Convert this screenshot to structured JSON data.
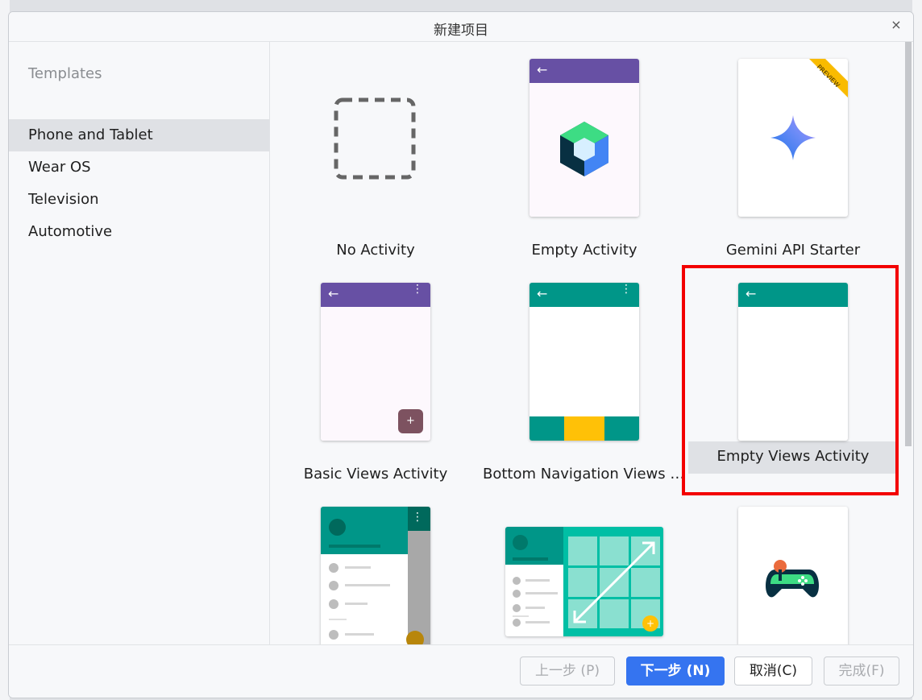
{
  "dialog": {
    "title": "新建项目",
    "close_glyph": "×"
  },
  "sidebar": {
    "header": "Templates",
    "items": [
      {
        "label": "Phone and Tablet",
        "selected": true
      },
      {
        "label": "Wear OS"
      },
      {
        "label": "Television"
      },
      {
        "label": "Automotive"
      }
    ]
  },
  "templates": [
    {
      "label": "No Activity"
    },
    {
      "label": "Empty Activity"
    },
    {
      "label": "Gemini API Starter",
      "badge": "PREVIEW"
    },
    {
      "label": "Basic Views Activity",
      "fab": "+"
    },
    {
      "label": "Bottom Navigation Views Act..."
    },
    {
      "label": "Empty Views Activity",
      "selected": true
    },
    {
      "label": ""
    },
    {
      "label": ""
    },
    {
      "label": ""
    }
  ],
  "footer": {
    "prev": "上一步 (P)",
    "next": "下一步 (N)",
    "cancel": "取消(C)",
    "finish": "完成(F)"
  },
  "colors": {
    "purple": "#6750a4",
    "teal": "#009688",
    "yellow": "#ffc107",
    "accent": "#3574f0",
    "highlight": "#f30000"
  }
}
